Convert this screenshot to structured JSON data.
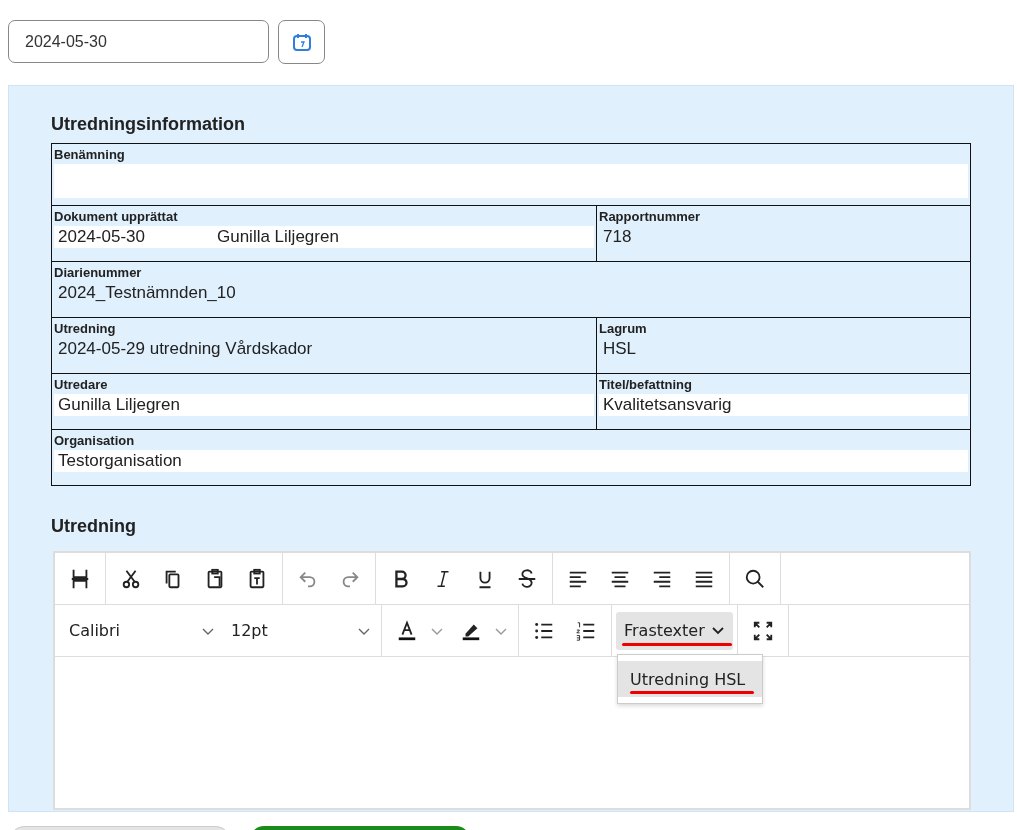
{
  "date_field": {
    "value": "2024-05-30"
  },
  "panel": {
    "heading": "Utredningsinformation",
    "rows": [
      {
        "cells": [
          {
            "label": "Benämning",
            "field": true,
            "tall": true
          }
        ]
      },
      {
        "cells": [
          {
            "label": "Dokument upprättat",
            "values": [
              "2024-05-30",
              "Gunilla Liljegren"
            ],
            "field": true
          },
          {
            "label": "Rapportnummer",
            "values": [
              "718"
            ],
            "field": false
          }
        ]
      },
      {
        "cells": [
          {
            "label": "Diarienummer",
            "values": [
              "2024_Testnämnden_10"
            ],
            "field": false
          }
        ]
      },
      {
        "cells": [
          {
            "label": "Utredning",
            "values": [
              "2024-05-29 utredning Vårdskador"
            ],
            "field": false
          },
          {
            "label": "Lagrum",
            "values": [
              "HSL"
            ],
            "field": false
          }
        ]
      },
      {
        "cells": [
          {
            "label": "Utredare",
            "values": [
              "Gunilla Liljegren"
            ],
            "field": true
          },
          {
            "label": "Titel/befattning",
            "values": [
              "Kvalitetsansvarig"
            ],
            "field": true
          }
        ]
      },
      {
        "cells": [
          {
            "label": "Organisation",
            "values": [
              "Testorganisation"
            ],
            "field": true
          }
        ]
      }
    ],
    "editor_heading": "Utredning",
    "editor": {
      "font": "Calibri",
      "size": "12pt",
      "phrases": {
        "label": "Frastexter",
        "expanded": true,
        "items": [
          {
            "label": "Utredning HSL",
            "selected": true
          }
        ]
      }
    }
  }
}
